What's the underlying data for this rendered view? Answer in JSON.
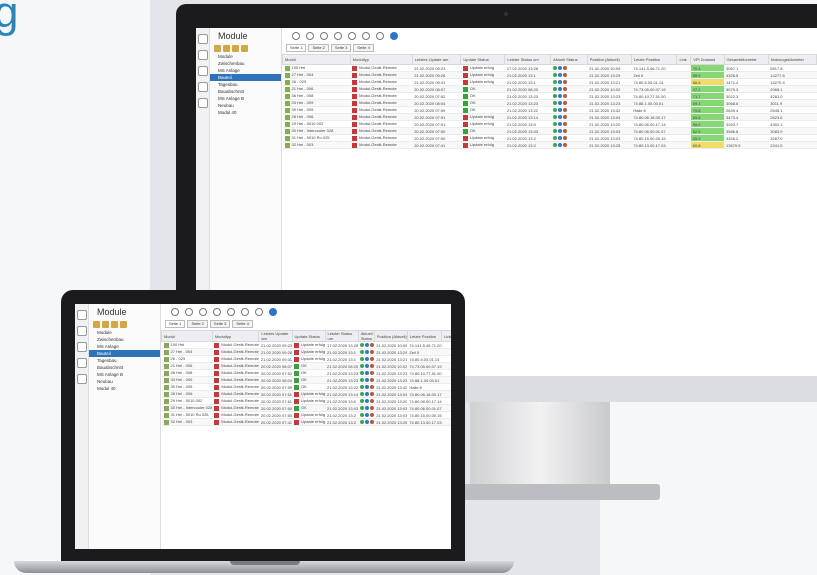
{
  "headline_fragment": "g",
  "app": {
    "module_title": "Module",
    "tree": [
      {
        "label": "Module",
        "selected": false
      },
      {
        "label": "Zwischenbau",
        "selected": false
      },
      {
        "label": "MS Anlage",
        "selected": false
      },
      {
        "label": "Bauteil",
        "selected": true
      },
      {
        "label": "Tagesbau",
        "selected": false
      },
      {
        "label": "Bauabschnitt",
        "selected": false
      },
      {
        "label": "MS Anlage B",
        "selected": false
      },
      {
        "label": "Neubau",
        "selected": false
      },
      {
        "label": "Modul 40",
        "selected": false
      }
    ],
    "tabs": [
      "Seite 1",
      "Seite 2",
      "Seite 3",
      "Seite 4"
    ],
    "columns": [
      "Modul",
      "Modultyp",
      "Letztes Update am",
      "Update Status",
      "Letzter Status um",
      "Aktuell Status",
      "Position (Aktuell)",
      "Letzte Position",
      "Link",
      "VPI Zustand",
      "Gesamtkilometer",
      "Nutzungskilometer"
    ],
    "rows": [
      {
        "modul": "100 Hei",
        "typ": "Modul-Gerät-Remote",
        "date": "21.02.2020 09:23",
        "status": "Update erfolg",
        "t": "17.02.2020 13:28",
        "pos": "21.02.2020 10:09",
        "addr": "74.141.5.46.71.20",
        "vpi": "70.4",
        "km": "3067.1",
        "nkm": "5817.8",
        "vclass": "green"
      },
      {
        "modul": "27 Hei - 004",
        "typ": "Modul-Gerät-Remote",
        "date": "21.02.2020 09:28",
        "status": "Update erfolg",
        "t": "21.02.2020 13:1",
        "pos": "21.02.2020 13:29",
        "addr": "Zeil 5",
        "vpi": "59.9",
        "km": "4326.5",
        "nkm": "14277.6",
        "vclass": "green"
      },
      {
        "modul": "26 - 029",
        "typ": "Modul-Gerät-Remote",
        "date": "21.02.2020 09:31",
        "status": "Update erfolg",
        "t": "21.02.2020 13:1",
        "pos": "21.02.2020 13:21",
        "addr": "74.80.5.00.01.14",
        "vpi": "66.6",
        "km": "1471.4",
        "nkm": "14270.4",
        "vclass": "yellow"
      },
      {
        "modul": "21 Hei - 006",
        "typ": "Modul-Gerät-Remote",
        "date": "20.02.2020 08:07",
        "status": "OK",
        "t": "21.02.2020 08:20",
        "pos": "21.02.2020 10:02",
        "addr": "74.73.05.00.07.19",
        "vpi": "47.1",
        "km": "3079.3",
        "nkm": "2065.1",
        "vclass": "green"
      },
      {
        "modul": "36 Hei - 008",
        "typ": "Modul-Gerät-Remote",
        "date": "20.02.2020 07:52",
        "status": "OK",
        "t": "21.02.2020 13:23",
        "pos": "21.02.2020 13:23",
        "addr": "74.80.10.77.51.00",
        "vpi": "71.7",
        "km": "3022.3",
        "nkm": "4281.0",
        "vclass": "green"
      },
      {
        "modul": "33 Hei - 009",
        "typ": "Modul-Gerät-Remote",
        "date": "20.02.2020 08:04",
        "status": "OK",
        "t": "21.02.2020 13:23",
        "pos": "21.02.2020 13:23",
        "addr": "74.88.1.00.00.01",
        "vpi": "69.1",
        "km": "3068.6",
        "nkm": "3011.9",
        "vclass": "green"
      },
      {
        "modul": "39 Hei - 005",
        "typ": "Modul-Gerät-Remote",
        "date": "20.02.2020 07:59",
        "status": "OK",
        "t": "21.02.2020 13:22",
        "pos": "21.02.2020 13:42",
        "addr": "Halle 8",
        "vpi": "70.8",
        "km": "2649.4",
        "nkm": "2645.1",
        "vclass": "green"
      },
      {
        "modul": "28 Hei - 006",
        "typ": "Modul-Gerät-Remote",
        "date": "20.02.2020 07:51",
        "status": "Update erfolg",
        "t": "21.02.2020 13:14",
        "pos": "21.02.2020 13:04",
        "addr": "74.80.06.18.00.17",
        "vpi": "69.8",
        "km": "3473.4",
        "nkm": "2623.6",
        "vclass": "green"
      },
      {
        "modul": "29 Hei - 5010 002",
        "typ": "Modul-Gerät-Remote",
        "date": "20.02.2020 07:51",
        "status": "Update erfolg",
        "t": "21.02.2020 13:0",
        "pos": "21.02.2020 13:20",
        "addr": "74.80.06.00.17.14",
        "vpi": "55.0",
        "km": "3263.7",
        "nkm": "4302.1",
        "vclass": "green"
      },
      {
        "modul": "30 Hei - Intercooler 028",
        "typ": "Modul-Gerät-Remote",
        "date": "20.02.2020 07:50",
        "status": "OK",
        "t": "21.02.2020 13:03",
        "pos": "21.02.2020 13:03",
        "addr": "74.80.06.00.01.07",
        "vpi": "62.5",
        "km": "3586.8",
        "nkm": "3083.9",
        "vclass": "green"
      },
      {
        "modul": "31 Hei - 5010 Ro 025",
        "typ": "Modul-Gerät-Remote",
        "date": "20.02.2020 07:50",
        "status": "Update erfolg",
        "t": "21.02.2020 13:2",
        "pos": "21.02.2020 13:03",
        "addr": "74.80.15.00.00.15",
        "vpi": "55.9",
        "km": "3346.2",
        "nkm": "3267.0",
        "vclass": "green"
      },
      {
        "modul": "32 Hei - 003",
        "typ": "Modul-Gerät-Remote",
        "date": "20.02.2020 07:41",
        "status": "Update erfolg",
        "t": "21.02.2020 13:2",
        "pos": "21.02.2020 13:25",
        "addr": "74.80.13.00.17.03",
        "vpi": "60.8",
        "km": "13579.5",
        "nkm": "2241.5",
        "vclass": "yellow"
      }
    ]
  }
}
